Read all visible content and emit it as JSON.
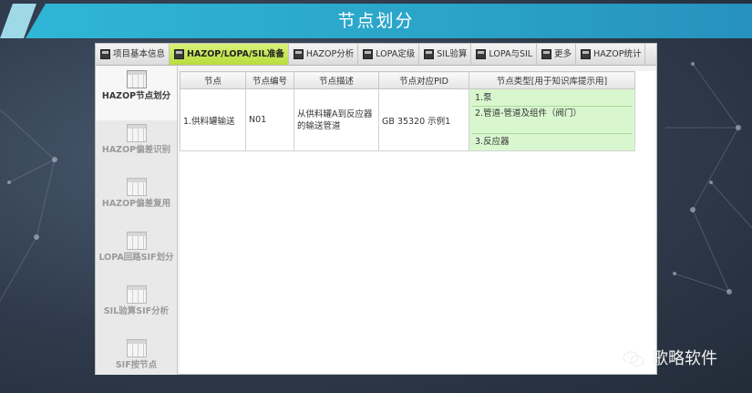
{
  "banner": {
    "title": "节点划分"
  },
  "tabs": [
    {
      "label": "项目基本信息",
      "active": false
    },
    {
      "label": "HAZOP/LOPA/SIL准备",
      "active": true
    },
    {
      "label": "HAZOP分析",
      "active": false
    },
    {
      "label": "LOPA定级",
      "active": false
    },
    {
      "label": "SIL验算",
      "active": false
    },
    {
      "label": "LOPA与SIL",
      "active": false
    },
    {
      "label": "更多",
      "active": false
    },
    {
      "label": "HAZOP统计",
      "active": false
    }
  ],
  "sidebar": {
    "items": [
      {
        "label": "HAZOP节点划分",
        "active": true
      },
      {
        "label": "HAZOP偏差识别",
        "active": false
      },
      {
        "label": "HAZOP偏差复用",
        "active": false
      },
      {
        "label": "LOPA回路SIF划分",
        "active": false
      },
      {
        "label": "SIL验算SIF分析",
        "active": false
      },
      {
        "label": "SIF按节点",
        "active": false
      }
    ]
  },
  "table": {
    "columns": [
      "节点",
      "节点编号",
      "节点描述",
      "节点对应PID",
      "节点类型[用于知识库提示用]"
    ],
    "rows": [
      {
        "node": "1.供料罐输送",
        "code": "N01",
        "description": "从供料罐A到反应器的输送管道",
        "pid": "GB 35320 示例1",
        "types": [
          "1.泵",
          "2.管道-管道及组件（阀门）",
          "3.反应器"
        ]
      }
    ]
  },
  "watermark": {
    "text": "歌略软件"
  },
  "colors": {
    "banner": "#2aa3c8",
    "active_tab": "#c6e553",
    "type_cell": "#d9f7cf"
  }
}
